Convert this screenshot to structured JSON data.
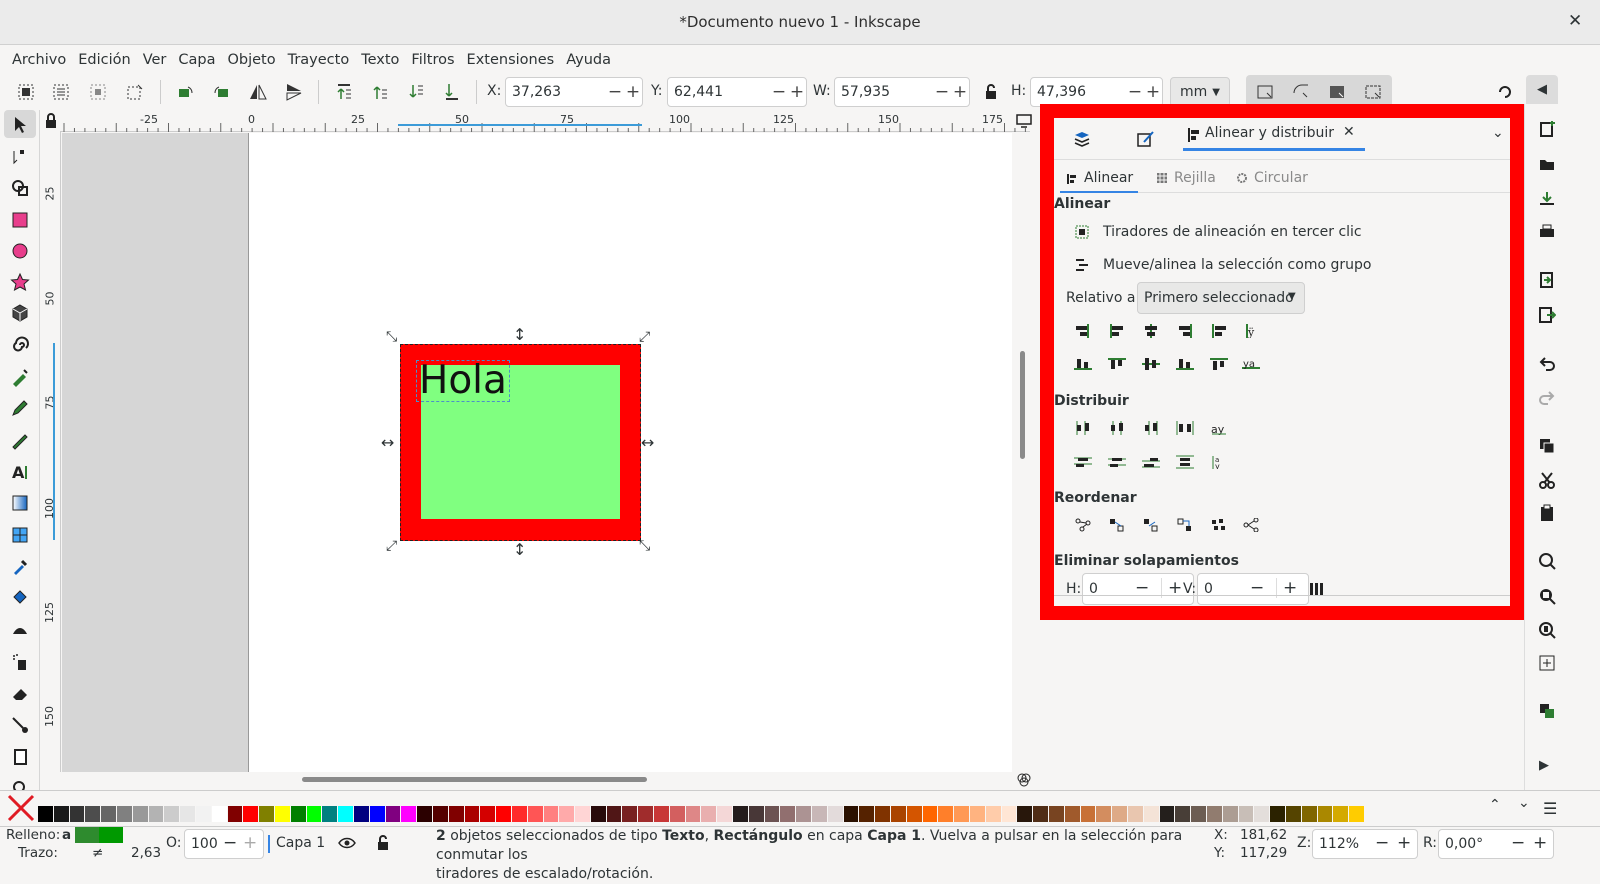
{
  "window": {
    "title": "*Documento nuevo 1 - Inkscape",
    "close": "✕"
  },
  "menu": [
    "Archivo",
    "Edición",
    "Ver",
    "Capa",
    "Objeto",
    "Trayecto",
    "Texto",
    "Filtros",
    "Extensiones",
    "Ayuda"
  ],
  "toolbar": {
    "x_label": "X:",
    "x_value": "37,263",
    "y_label": "Y:",
    "y_value": "62,441",
    "w_label": "W:",
    "w_value": "57,935",
    "h_label": "H:",
    "h_value": "47,396",
    "unit": "mm",
    "minus": "−",
    "plus": "+"
  },
  "ruler": {
    "h_ticks": [
      "-25",
      "0",
      "25",
      "50",
      "75",
      "100",
      "125",
      "150",
      "175"
    ],
    "v_ticks": [
      "25",
      "50",
      "75",
      "100",
      "125",
      "150"
    ]
  },
  "canvas": {
    "text_object": "Hola",
    "colors": {
      "rect_stroke": "#ff0000",
      "rect_fill": "#80ff80"
    }
  },
  "dock": {
    "tab_active": "Alinear y distribuir",
    "subtabs": [
      "Alinear",
      "Rejilla",
      "Circular"
    ],
    "section_align": "Alinear",
    "opt1": "Tiradores de alineación en tercer clic",
    "opt2": "Mueve/alinea la selección como grupo",
    "relative_label": "Relativo a:",
    "relative_value": "Primero seleccionado",
    "section_distribute": "Distribuir",
    "section_reorder": "Reordenar",
    "section_overlap": "Eliminar solapamientos",
    "h_label": "H:",
    "h_value": "0",
    "v_label": "V:",
    "v_value": "0"
  },
  "palette": {
    "colors": [
      "#000000",
      "#1a1a1a",
      "#333333",
      "#4d4d4d",
      "#666666",
      "#808080",
      "#999999",
      "#b3b3b3",
      "#cccccc",
      "#e6e6e6",
      "#f2f2f2",
      "#ffffff",
      "#800000",
      "#ff0000",
      "#808000",
      "#ffff00",
      "#008000",
      "#00ff00",
      "#008080",
      "#00ffff",
      "#000080",
      "#0000ff",
      "#800080",
      "#ff00ff",
      "#2b0000",
      "#550000",
      "#800000",
      "#aa0000",
      "#d40000",
      "#ff0000",
      "#ff2a2a",
      "#ff5555",
      "#ff8080",
      "#ffaaaa",
      "#ffd5d5",
      "#280b0b",
      "#501616",
      "#782121",
      "#a02c2c",
      "#c83737",
      "#d35f5f",
      "#de8787",
      "#e9afaf",
      "#f4d7d7",
      "#241c1c",
      "#483737",
      "#6c5353",
      "#916f6f",
      "#ac9393",
      "#c8b7b7",
      "#e3dbdb",
      "#2b1100",
      "#552200",
      "#803300",
      "#aa4400",
      "#d45500",
      "#ff6600",
      "#ff7f2a",
      "#ff9955",
      "#ffb380",
      "#ffccaa",
      "#ffe6d5",
      "#28170b",
      "#502d16",
      "#784421",
      "#a05a2c",
      "#c87137",
      "#d38d5f",
      "#deaa87",
      "#e9c6af",
      "#f4e3d7",
      "#241f1c",
      "#483e37",
      "#6c5d53",
      "#917c6f",
      "#ac9d93",
      "#c8beb7",
      "#e3dedb",
      "#2b2200",
      "#554400",
      "#806600",
      "#aa8800",
      "#d4aa00",
      "#ffcc00"
    ]
  },
  "status": {
    "fill_label": "Relleno:",
    "fill_value": "a",
    "stroke_label": "Trazo:",
    "stroke_value": "≠",
    "stroke_width": "2,63",
    "opacity_label": "O:",
    "opacity_value": "100",
    "layer": "Capa 1",
    "message_bold1": "2",
    "message_part1": " objetos seleccionados de tipo ",
    "message_bold2": "Texto",
    "message_part2": ", ",
    "message_bold3": "Rectángulo",
    "message_part3": " en capa ",
    "message_bold4": "Capa 1",
    "message_part4": ". Vuelva a pulsar en la selección para conmutar los",
    "message_line2": "tiradores de escalado/rotación.",
    "cx_label": "X:",
    "cx_value": "181,62",
    "cy_label": "Y:",
    "cy_value": "117,29",
    "zoom_label": "Z:",
    "zoom_value": "112%",
    "rot_label": "R:",
    "rot_value": "0,00°"
  }
}
